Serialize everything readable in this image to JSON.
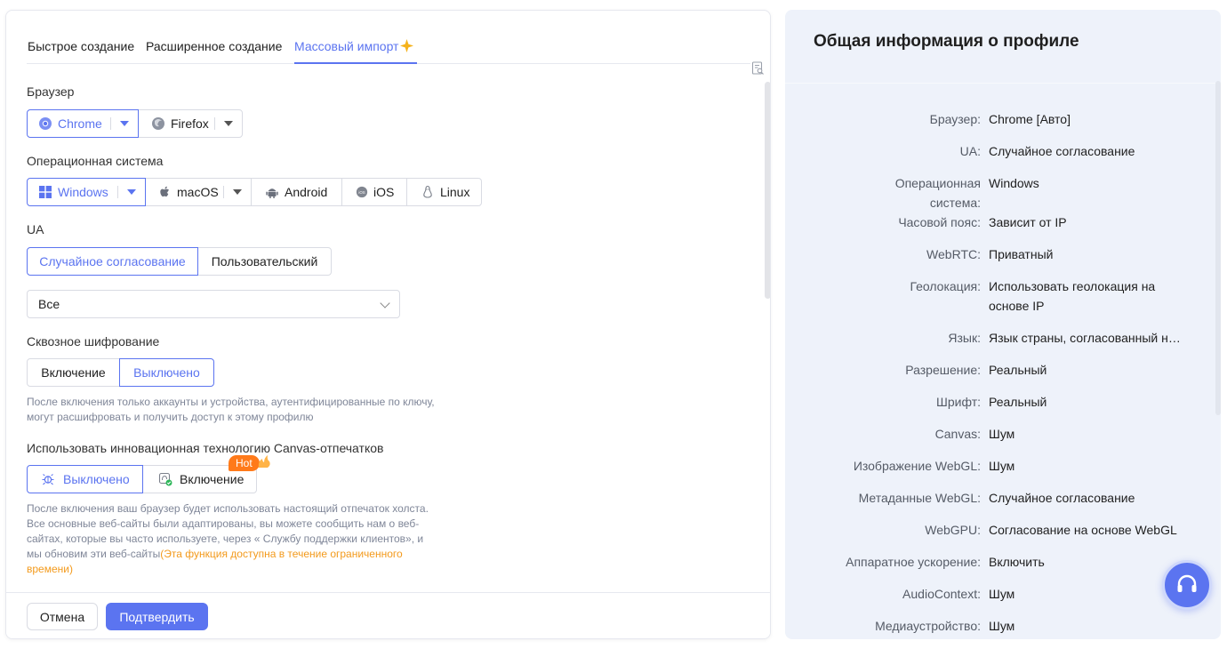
{
  "tabs": [
    {
      "label": "Быстрое создание"
    },
    {
      "label": "Расширенное создание"
    },
    {
      "label": "Массовый импорт"
    }
  ],
  "browser": {
    "label": "Браузер",
    "options": [
      {
        "label": "Chrome",
        "icon": "chrome-icon",
        "selected": true
      },
      {
        "label": "Firefox",
        "icon": "firefox-icon",
        "selected": false
      }
    ]
  },
  "os": {
    "label": "Операционная система",
    "options": [
      {
        "label": "Windows",
        "icon": "windows-icon",
        "selected": true
      },
      {
        "label": "macOS",
        "icon": "apple-icon",
        "selected": false
      },
      {
        "label": "Android",
        "icon": "android-icon",
        "selected": false
      },
      {
        "label": "iOS",
        "icon": "ios-icon",
        "selected": false
      },
      {
        "label": "Linux",
        "icon": "linux-icon",
        "selected": false
      }
    ]
  },
  "ua": {
    "label": "UA",
    "options": [
      {
        "label": "Случайное согласование",
        "selected": true
      },
      {
        "label": "Пользовательский",
        "selected": false
      }
    ],
    "select_value": "Все"
  },
  "encryption": {
    "label": "Сквозное шифрование",
    "options": [
      {
        "label": "Включение",
        "selected": false
      },
      {
        "label": "Выключено",
        "selected": true
      }
    ],
    "hint_line1": "После включения только аккаунты и устройства, аутентифицированные по ключу,",
    "hint_line2": "могут расшифровать и получить доступ к этому профилю"
  },
  "canvas": {
    "label": "Использовать инновационная технологию Canvas-отпечатков",
    "options": [
      {
        "label": "Выключено",
        "selected": true
      },
      {
        "label": "Включение",
        "selected": false
      }
    ],
    "badge": "Hot",
    "hint_line1": "После включения ваш браузер будет использовать настоящий отпечаток холста.",
    "hint_line2": "Все основные веб-сайты были адаптированы, вы можете сообщить нам о веб-",
    "hint_line3": "сайтах, которые вы часто используете, через « Службу поддержки клиентов», и",
    "hint_line4": "мы обновим эти веб-сайты",
    "hint_orange1": "(Эта функция доступна в течение ограниченного",
    "hint_orange2": "времени)"
  },
  "footer": {
    "cancel": "Отмена",
    "confirm": "Подтвердить"
  },
  "summary": {
    "title": "Общая информация о профиле",
    "rows": [
      {
        "label": "Браузер:",
        "value": "Chrome [Авто]"
      },
      {
        "label": "UA:",
        "value": "Случайное согласование"
      },
      {
        "label": "Операционная система:",
        "value": "Windows"
      },
      {
        "label": "Часовой пояс:",
        "value": "Зависит от IP"
      },
      {
        "label": "WebRTC:",
        "value": "Приватный"
      },
      {
        "label": "Геолокация:",
        "value": "Использовать геолокация на основе IP"
      },
      {
        "label": "Язык:",
        "value": "Язык страны, согласованный на..."
      },
      {
        "label": "Разрешение:",
        "value": "Реальный"
      },
      {
        "label": "Шрифт:",
        "value": "Реальный"
      },
      {
        "label": "Canvas:",
        "value": "Шум"
      },
      {
        "label": "Изображение WebGL:",
        "value": "Шум"
      },
      {
        "label": "Метаданные WebGL:",
        "value": "Случайное согласование"
      },
      {
        "label": "WebGPU:",
        "value": "Согласование на основе WebGL"
      },
      {
        "label": "Аппаратное ускорение:",
        "value": "Включить"
      },
      {
        "label": "AudioContext:",
        "value": "Шум"
      },
      {
        "label": "Медиаустройство:",
        "value": "Шум"
      }
    ]
  },
  "colors": {
    "accent": "#5b74f0",
    "hot": "#ff7a1a",
    "hint_orange": "#f39a1c",
    "summary_bg": "#eef2fa"
  }
}
